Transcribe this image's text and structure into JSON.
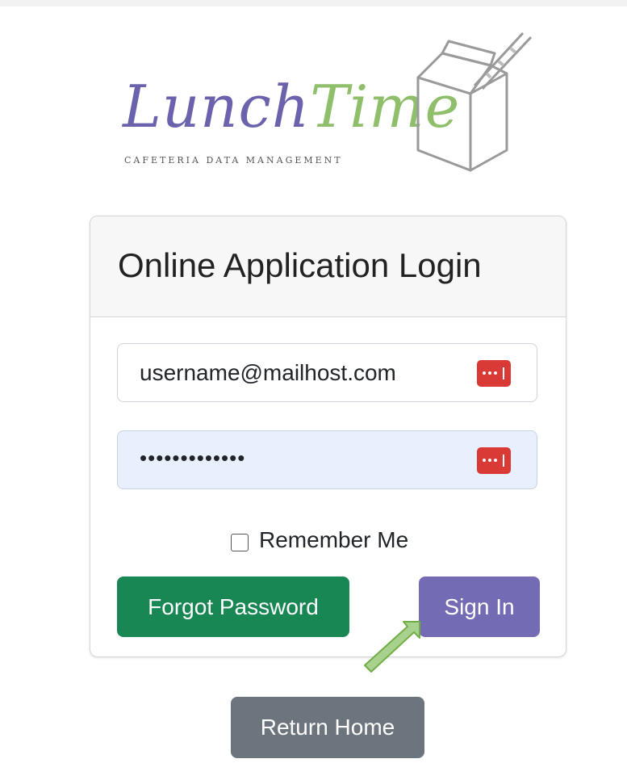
{
  "logo": {
    "word_part1": "Lunch",
    "word_part2": "Time",
    "tagline": "CAFETERIA DATA MANAGEMENT",
    "colors": {
      "lunch": "#6b62ad",
      "time": "#8fbf6a"
    }
  },
  "login_card": {
    "title": "Online Application Login",
    "username_value": "username@mailhost.com",
    "password_value": "•••••••••••••",
    "password_manager_icon": "password-manager-icon",
    "remember_label": "Remember Me",
    "remember_checked": false,
    "forgot_button": "Forgot Password",
    "signin_button": "Sign In"
  },
  "return_button": "Return Home",
  "colors": {
    "forgot": "#198754",
    "signin": "#736cb5",
    "return": "#6c757d",
    "annotation_arrow": "#a9d18e"
  }
}
